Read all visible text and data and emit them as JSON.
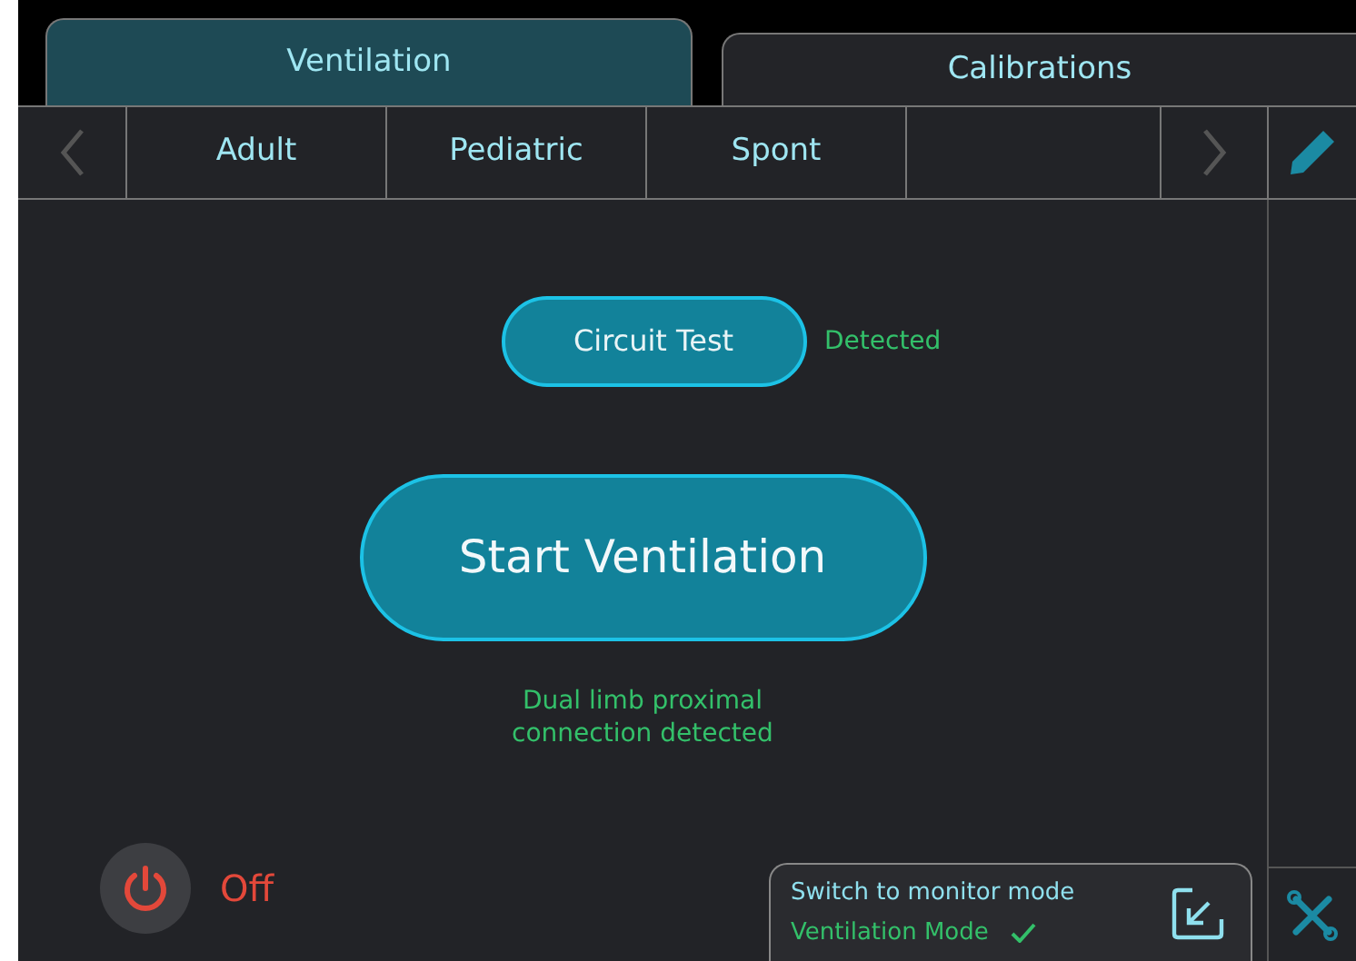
{
  "tabs": [
    {
      "label": "Ventilation",
      "selected": true
    },
    {
      "label": "Calibrations",
      "selected": false
    }
  ],
  "modes": [
    {
      "label": "Adult"
    },
    {
      "label": "Pediatric"
    },
    {
      "label": "Spont"
    }
  ],
  "circuit_test": {
    "label": "Circuit Test",
    "status": "Detected"
  },
  "start_button": "Start Ventilation",
  "connection_message": "Dual limb proximal connection detected",
  "power": {
    "label": "Off",
    "on": false
  },
  "monitor_switch": {
    "label": "Switch to monitor mode",
    "mode": "Ventilation Mode",
    "checked": true
  }
}
